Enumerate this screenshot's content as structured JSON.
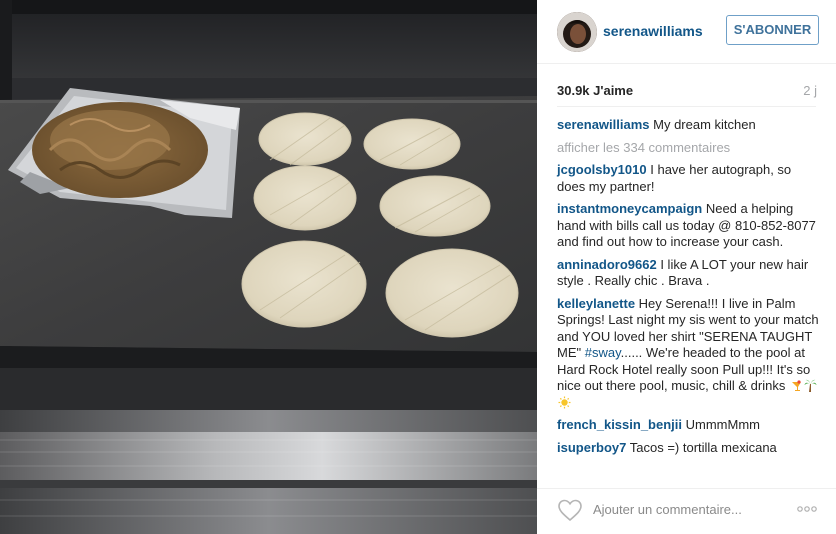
{
  "header": {
    "username": "serenawilliams",
    "follow_label": "S'ABONNER"
  },
  "stats": {
    "likes": "30.9k J'aime",
    "time_ago": "2 j"
  },
  "caption": {
    "username": "serenawilliams",
    "text": "My dream kitchen"
  },
  "load_more": "afficher les 334 commentaires",
  "comments": [
    {
      "username": "jcgoolsby1010",
      "text": "I have her autograph, so does my partner!"
    },
    {
      "username": "instantmoneycampaign",
      "text": "Need a helping hand with bills call us today @ 810-852-8077 and find out how to increase your cash."
    },
    {
      "username": "anninadoro9662",
      "text": "I like A LOT your new hair style . Really chic . Brava ."
    },
    {
      "username": "kelleylanette",
      "text_before": "Hey Serena!!! I live in Palm Springs! Last night my sis went to your match and YOU loved her shirt \"SERENA TAUGHT ME\" ",
      "hashtag": "#sway",
      "text_after": "...... We're headed to the pool at Hard Rock Hotel really soon Pull up!!! It's so nice out there pool, music, chill & drinks "
    },
    {
      "username": "french_kissin_benjii",
      "text": "UmmmMmm"
    },
    {
      "username": "isuperboy7",
      "text": "Tacos =) tortilla mexicana"
    }
  ],
  "comment_box": {
    "placeholder": "Ajouter un commentaire..."
  },
  "icons": {
    "like": "heart-outline-icon",
    "more": "more-options-icon"
  },
  "colors": {
    "username": "#125688",
    "follow_border": "#6fa0c8",
    "follow_text": "#3f729b",
    "muted": "#a5a7aa"
  }
}
